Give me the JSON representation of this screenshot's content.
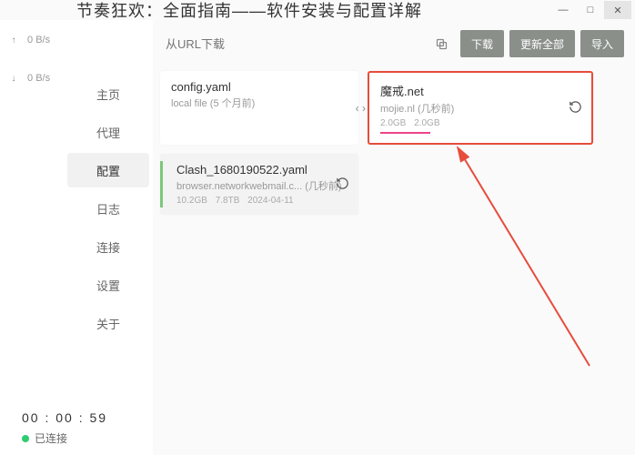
{
  "title": "节奏狂欢：全面指南——软件安装与配置详解",
  "speed": {
    "up_arrow": "↑",
    "up_val": "0",
    "up_unit": "B/s",
    "down_arrow": "↓",
    "down_val": "0",
    "down_unit": "B/s"
  },
  "sidebar": {
    "items": [
      {
        "label": "主页"
      },
      {
        "label": "代理"
      },
      {
        "label": "配置"
      },
      {
        "label": "日志"
      },
      {
        "label": "连接"
      },
      {
        "label": "设置"
      },
      {
        "label": "关于"
      }
    ]
  },
  "urlbar": {
    "placeholder": "从URL下载"
  },
  "buttons": {
    "download": "下载",
    "update_all": "更新全部",
    "import": "导入"
  },
  "cards": {
    "config": {
      "title": "config.yaml",
      "sub": "local file (5 个月前)"
    },
    "mojie": {
      "title": "魔戒.net",
      "sub_host": "mojie.nl",
      "sub_time": "(几秒前)",
      "meta1": "2.0GB",
      "meta2": "2.0GB"
    },
    "clash": {
      "title": "Clash_1680190522.yaml",
      "sub_host": "browser.networkwebmail.c...",
      "sub_time": "(几秒前)",
      "meta1": "10.2GB",
      "meta2": "7.8TB",
      "meta3": "2024-04-11"
    }
  },
  "footer": {
    "timer": "00 : 00 : 59",
    "status": "已连接"
  }
}
